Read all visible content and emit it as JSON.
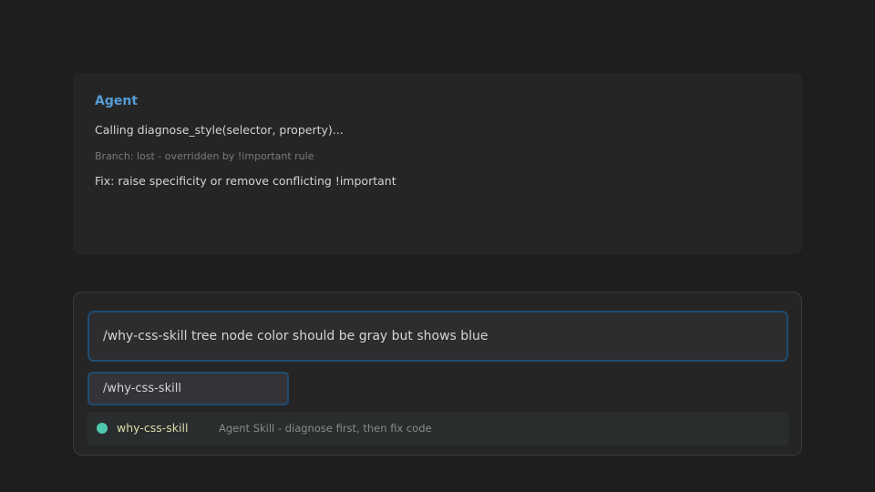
{
  "agent": {
    "title": "Agent",
    "call_line": "Calling diagnose_style(selector, property)...",
    "branch_line": "Branch: lost - overridden by !important rule",
    "fix_line": "Fix: raise specificity or remove conflicting !important"
  },
  "input": {
    "value": "/why-css-skill tree node color should be gray but shows blue",
    "command_chip": "/why-css-skill"
  },
  "suggestion": {
    "icon": "status-dot-icon",
    "name": "why-css-skill",
    "description": "Agent Skill - diagnose first, then fix code"
  },
  "colors": {
    "background": "#1e1e1e",
    "panel": "#252526",
    "accent_blue": "#569cd6",
    "focus_border": "#1e4d72",
    "dot_teal": "#4ec9b0",
    "skill_name_yellow": "#dcdcaa"
  }
}
